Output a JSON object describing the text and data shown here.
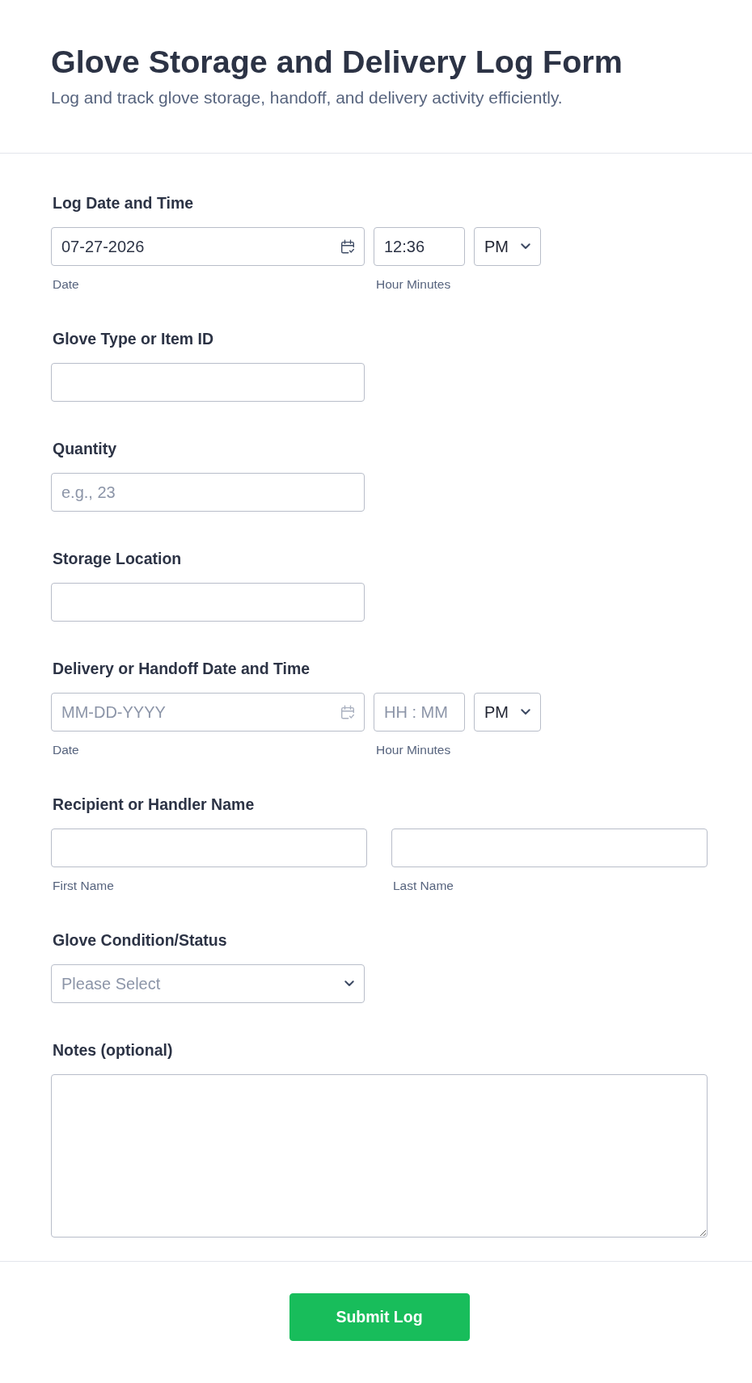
{
  "header": {
    "title": "Glove Storage and Delivery Log Form",
    "subtitle": "Log and track glove storage, handoff, and delivery activity efficiently."
  },
  "fields": [
    {
      "kind": "datetime",
      "label": "Log Date and Time",
      "date": {
        "value": "07-27-2026"
      },
      "time": {
        "value": "12:36"
      },
      "ampm": {
        "value": "PM"
      },
      "date_caption": "Date",
      "time_caption": "Hour Minutes"
    },
    {
      "kind": "text",
      "label": "Glove Type or Item ID"
    },
    {
      "kind": "text",
      "label": "Quantity",
      "placeholder": "e.g., 23"
    },
    {
      "kind": "text",
      "label": "Storage Location"
    },
    {
      "kind": "datetime",
      "label": "Delivery or Handoff Date and Time",
      "date": {
        "placeholder": "MM-DD-YYYY"
      },
      "time": {
        "placeholder": "HH : MM"
      },
      "ampm": {
        "value": "PM"
      },
      "date_caption": "Date",
      "time_caption": "Hour Minutes"
    },
    {
      "kind": "name",
      "label": "Recipient or Handler Name",
      "first_caption": "First Name",
      "last_caption": "Last Name"
    },
    {
      "kind": "select",
      "label": "Glove Condition/Status",
      "placeholder": "Please Select"
    },
    {
      "kind": "textarea",
      "label": "Notes (optional)"
    }
  ],
  "submit": {
    "label": "Submit Log"
  }
}
